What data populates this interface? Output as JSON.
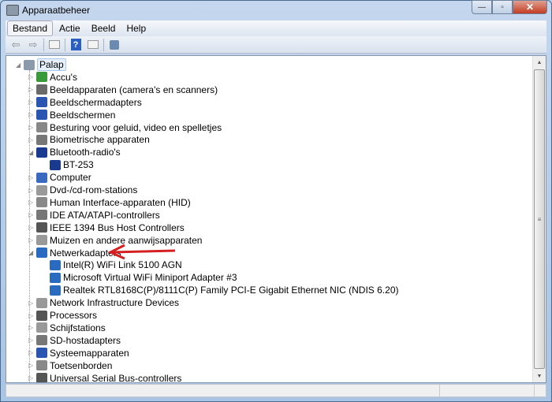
{
  "window": {
    "title": "Apparaatbeheer",
    "minimize": "—",
    "maximize": "▫",
    "close": "✕"
  },
  "menu": [
    "Bestand",
    "Actie",
    "Beeld",
    "Help"
  ],
  "toolbar": {
    "back": "⇦",
    "forward": "⇨",
    "help": "?"
  },
  "tree": {
    "root": "Palap",
    "items": [
      {
        "label": "Accu's",
        "color": "#3a9a3a"
      },
      {
        "label": "Beeldapparaten (camera's en scanners)",
        "color": "#6a6a6a"
      },
      {
        "label": "Beeldschermadapters",
        "color": "#2a55b0"
      },
      {
        "label": "Beeldschermen",
        "color": "#2a55b0"
      },
      {
        "label": "Besturing voor geluid, video en spelletjes",
        "color": "#888"
      },
      {
        "label": "Biometrische apparaten",
        "color": "#777"
      },
      {
        "label": "Bluetooth-radio's",
        "color": "#1a3a90",
        "expanded": true,
        "children": [
          "BT-253"
        ]
      },
      {
        "label": "Computer",
        "color": "#3a6ac0"
      },
      {
        "label": "Dvd-/cd-rom-stations",
        "color": "#999"
      },
      {
        "label": "Human Interface-apparaten (HID)",
        "color": "#888"
      },
      {
        "label": "IDE ATA/ATAPI-controllers",
        "color": "#777"
      },
      {
        "label": "IEEE 1394 Bus Host Controllers",
        "color": "#555"
      },
      {
        "label": "Muizen en andere aanwijsapparaten",
        "color": "#999"
      },
      {
        "label": "Netwerkadapters",
        "color": "#2a6ac0",
        "expanded": true,
        "children": [
          "Intel(R) WiFi Link 5100 AGN",
          "Microsoft Virtual WiFi Miniport Adapter #3",
          "Realtek RTL8168C(P)/8111C(P) Family PCI-E Gigabit Ethernet NIC (NDIS 6.20)"
        ]
      },
      {
        "label": "Network Infrastructure Devices",
        "color": "#999"
      },
      {
        "label": "Processors",
        "color": "#555"
      },
      {
        "label": "Schijfstations",
        "color": "#999"
      },
      {
        "label": "SD-hostadapters",
        "color": "#777"
      },
      {
        "label": "Systeemapparaten",
        "color": "#2a55b0"
      },
      {
        "label": "Toetsenborden",
        "color": "#888"
      },
      {
        "label": "Universal Serial Bus-controllers",
        "color": "#555"
      }
    ]
  },
  "annotation_color": "#d42020"
}
